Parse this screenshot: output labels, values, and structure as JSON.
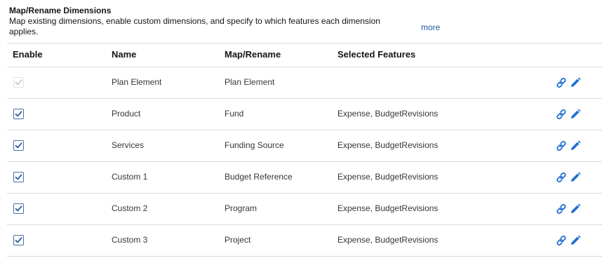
{
  "section": {
    "title": "Map/Rename Dimensions",
    "description": "Map existing dimensions, enable custom dimensions, and specify to which features each dimension applies.",
    "more_label": "more"
  },
  "table": {
    "headers": {
      "enable": "Enable",
      "name": "Name",
      "map": "Map/Rename",
      "features": "Selected Features"
    },
    "rows": [
      {
        "enabled": true,
        "disabled": true,
        "name": "Plan Element",
        "map": "Plan Element",
        "features": ""
      },
      {
        "enabled": true,
        "disabled": false,
        "name": "Product",
        "map": "Fund",
        "features": "Expense, BudgetRevisions"
      },
      {
        "enabled": true,
        "disabled": false,
        "name": "Services",
        "map": "Funding Source",
        "features": "Expense, BudgetRevisions"
      },
      {
        "enabled": true,
        "disabled": false,
        "name": "Custom 1",
        "map": "Budget Reference",
        "features": "Expense, BudgetRevisions"
      },
      {
        "enabled": true,
        "disabled": false,
        "name": "Custom 2",
        "map": "Program",
        "features": "Expense, BudgetRevisions"
      },
      {
        "enabled": true,
        "disabled": false,
        "name": "Custom 3",
        "map": "Project",
        "features": "Expense, BudgetRevisions"
      }
    ],
    "row_actions": [
      "link-icon",
      "edit-pencil-icon"
    ]
  },
  "colors": {
    "accent": "#1f6fd1",
    "check_enabled": "#2a5a9e",
    "check_disabled": "#c9c8c6",
    "divider": "#dcdbd9"
  }
}
